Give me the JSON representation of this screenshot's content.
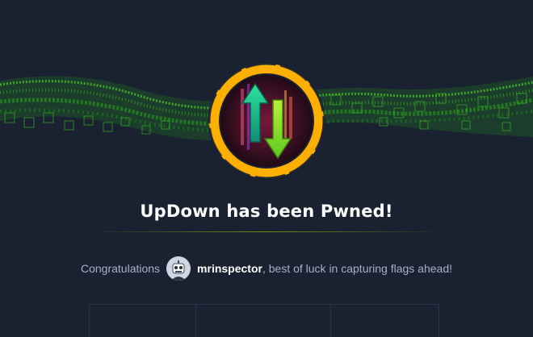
{
  "machine": {
    "name": "UpDown",
    "title": "UpDown has been Pwned!"
  },
  "congrats": {
    "prefix": "Congratulations",
    "username": "mrinspector",
    "suffix": ", best of luck in capturing flags ahead!"
  },
  "colors": {
    "background": "#1a2130",
    "accent_green": "#9fef00",
    "badge_ring": "#ffaf00",
    "text_muted": "#a4b1cd"
  }
}
